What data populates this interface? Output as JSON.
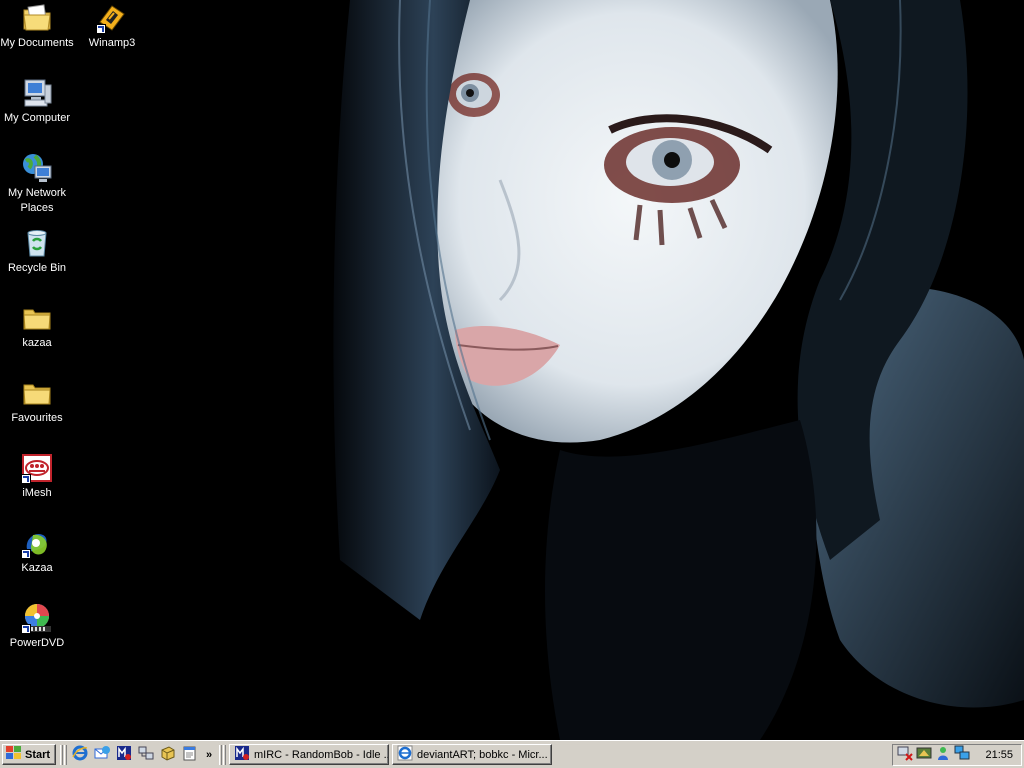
{
  "desktop": {
    "icons": [
      {
        "label": "My Documents",
        "icon": "my-documents-icon"
      },
      {
        "label": "Winamp3",
        "icon": "winamp-icon"
      },
      {
        "label": "My Computer",
        "icon": "my-computer-icon"
      },
      {
        "label": "My Network Places",
        "icon": "network-places-icon"
      },
      {
        "label": "Recycle Bin",
        "icon": "recycle-bin-icon"
      },
      {
        "label": "kazaa",
        "icon": "folder-icon"
      },
      {
        "label": "Favourites",
        "icon": "folder-icon"
      },
      {
        "label": "iMesh",
        "icon": "imesh-icon"
      },
      {
        "label": "Kazaa",
        "icon": "kazaa-icon"
      },
      {
        "label": "PowerDVD",
        "icon": "powerdvd-icon"
      }
    ],
    "wallpaper": "portrait-photo",
    "colors": {
      "wallpaper_bg": "#000000",
      "hair": "#1e2a3a",
      "skin": "#e9eef2"
    }
  },
  "taskbar": {
    "start_label": "Start",
    "quick_launch": [
      "internet-explorer-icon",
      "outlook-express-icon",
      "mirc-icon",
      "network-icon",
      "winzip-icon",
      "notepad-icon"
    ],
    "chevron": "»",
    "tasks": [
      {
        "label": "mIRC - RandomBob - Idle ...",
        "icon": "mirc-icon"
      },
      {
        "label": "deviantART; bobkc - Micr...",
        "icon": "internet-explorer-icon"
      }
    ],
    "tray_icons": [
      "network-disconnected-icon",
      "display-icon",
      "messenger-icon",
      "network-connection-icon"
    ],
    "clock": "21:55",
    "colors": {
      "face": "#d4d0c8"
    }
  }
}
